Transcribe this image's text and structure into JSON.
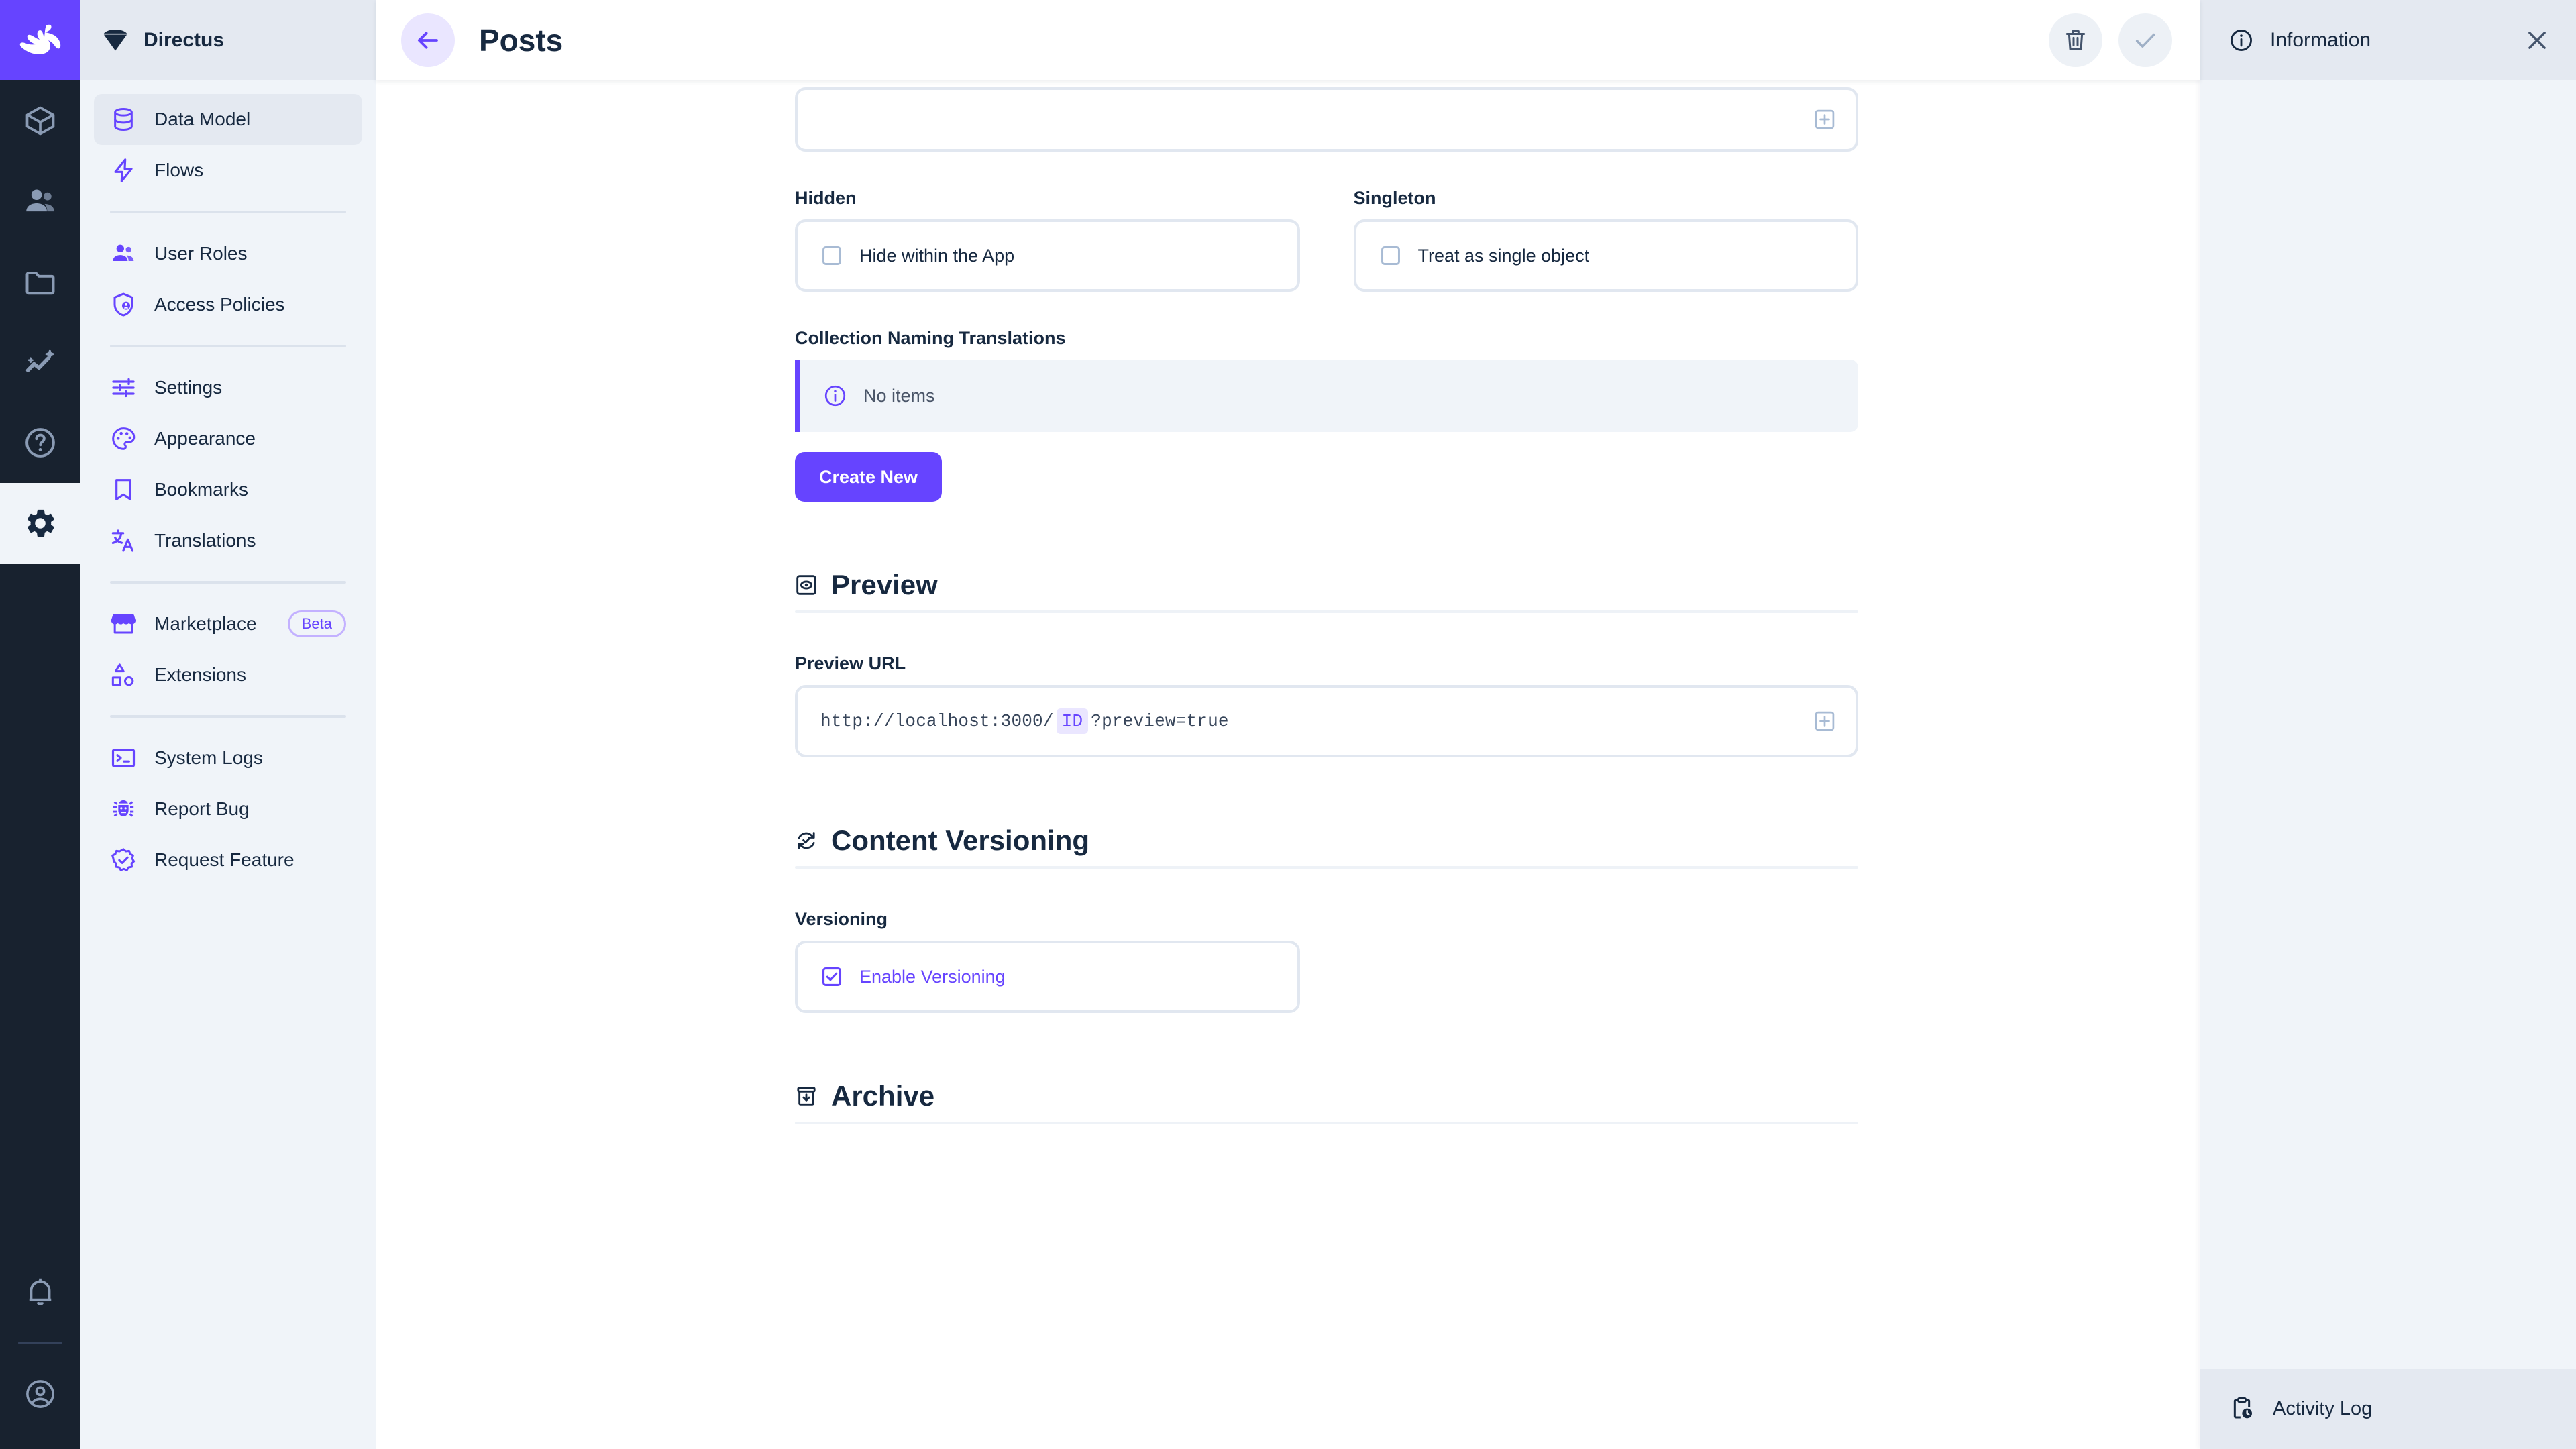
{
  "brand": {
    "name": "Directus",
    "accent": "#6644ff",
    "dark": "#18222f"
  },
  "rail": {
    "logo_icon": "directus-rabbit-logo",
    "items": [
      {
        "name": "content-module",
        "icon": "box-icon"
      },
      {
        "name": "users-module",
        "icon": "users-icon"
      },
      {
        "name": "files-module",
        "icon": "folder-icon"
      },
      {
        "name": "insights-module",
        "icon": "insights-sparkle-icon"
      },
      {
        "name": "docs-module",
        "icon": "help-circle-icon"
      },
      {
        "name": "settings-module",
        "icon": "gear-icon",
        "active": true
      }
    ],
    "bottom": [
      {
        "name": "notifications",
        "icon": "bell-icon"
      },
      {
        "name": "account",
        "icon": "account-circle-icon"
      }
    ]
  },
  "sidebar": {
    "title": "Directus",
    "title_icon": "directus-diamond-icon",
    "groups": [
      {
        "items": [
          {
            "label": "Data Model",
            "icon": "database-icon",
            "active": true
          },
          {
            "label": "Flows",
            "icon": "bolt-icon",
            "active": false
          }
        ]
      },
      {
        "items": [
          {
            "label": "User Roles",
            "icon": "people-icon",
            "active": false
          },
          {
            "label": "Access Policies",
            "icon": "shield-person-icon",
            "active": false
          }
        ]
      },
      {
        "items": [
          {
            "label": "Settings",
            "icon": "sliders-icon",
            "active": false
          },
          {
            "label": "Appearance",
            "icon": "palette-icon",
            "active": false
          },
          {
            "label": "Bookmarks",
            "icon": "bookmark-icon",
            "active": false
          },
          {
            "label": "Translations",
            "icon": "translate-icon",
            "active": false
          }
        ]
      },
      {
        "items": [
          {
            "label": "Marketplace",
            "icon": "storefront-icon",
            "badge": "Beta",
            "active": false
          },
          {
            "label": "Extensions",
            "icon": "shapes-icon",
            "active": false
          }
        ]
      },
      {
        "items": [
          {
            "label": "System Logs",
            "icon": "terminal-icon",
            "active": false
          },
          {
            "label": "Report Bug",
            "icon": "bug-icon",
            "active": false
          },
          {
            "label": "Request Feature",
            "icon": "verified-badge-icon",
            "active": false
          }
        ]
      }
    ]
  },
  "topbar": {
    "back_icon": "arrow-left-icon",
    "title": "Posts",
    "delete_icon": "trash-icon",
    "save_icon": "check-icon"
  },
  "form": {
    "top_field": {
      "value": "",
      "add_icon": "add-box-icon"
    },
    "hidden": {
      "label": "Hidden",
      "checkbox_label": "Hide within the App",
      "checked": false
    },
    "singleton": {
      "label": "Singleton",
      "checkbox_label": "Treat as single object",
      "checked": false
    },
    "translations": {
      "label": "Collection Naming Translations",
      "empty_text": "No items",
      "empty_icon": "info-circle-icon",
      "create_button": "Create New"
    }
  },
  "sections": {
    "preview": {
      "title": "Preview",
      "icon": "preview-eye-icon",
      "url_label": "Preview URL",
      "url_prefix": "http://localhost:3000/",
      "url_token": "ID",
      "url_suffix": "?preview=true",
      "add_icon": "add-box-icon"
    },
    "versioning": {
      "title": "Content Versioning",
      "icon": "version-sync-icon",
      "field_label": "Versioning",
      "checkbox_label": "Enable Versioning",
      "checked": true
    },
    "archive": {
      "title": "Archive",
      "icon": "archive-box-icon"
    }
  },
  "drawer": {
    "title": "Information",
    "info_icon": "info-circle-icon",
    "close_icon": "close-x-icon",
    "activity_label": "Activity Log",
    "activity_icon": "clipboard-clock-icon"
  }
}
